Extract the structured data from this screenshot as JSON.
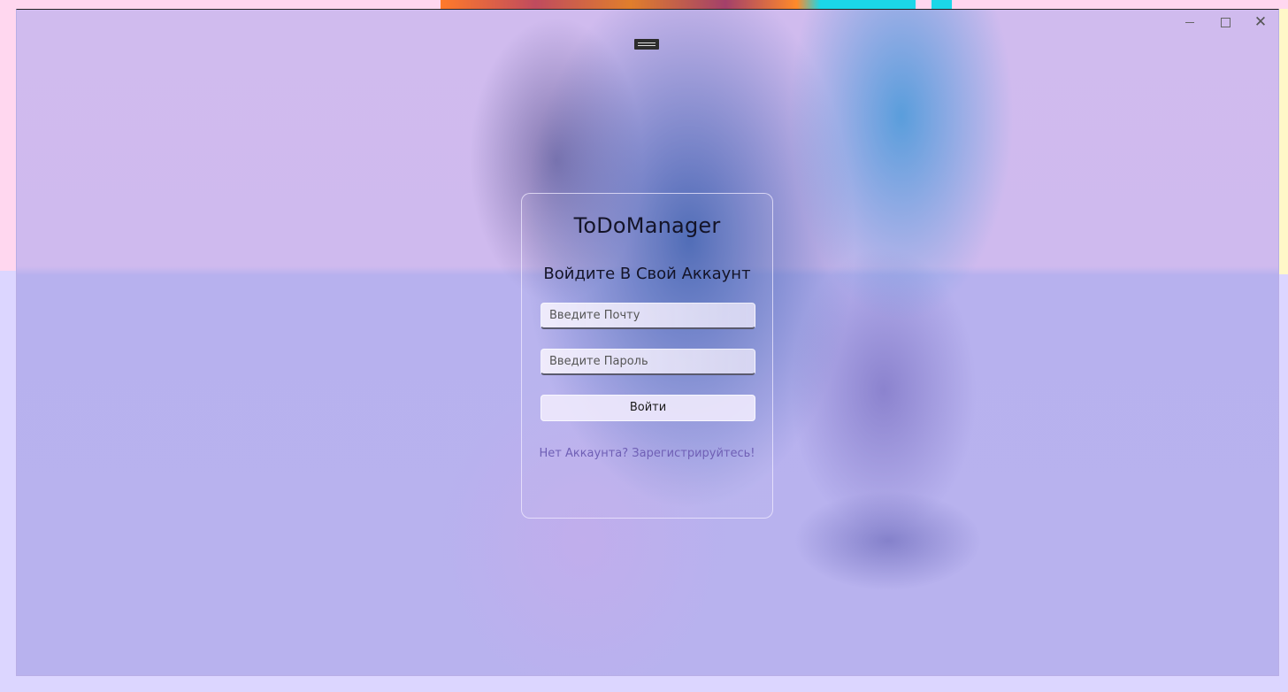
{
  "window": {
    "caption_minimize": "–",
    "caption_maximize": "□",
    "caption_close": "✕",
    "icons": [
      "minimize-icon",
      "maximize-icon",
      "close-icon",
      "drag-handle-icon"
    ]
  },
  "login": {
    "app_title": "ToDoManager",
    "subtitle": "Войдите В Свой Аккаунт",
    "email_placeholder": "Введите Почту",
    "email_value": "",
    "password_placeholder": "Введите Пароль",
    "password_value": "",
    "submit_label": "Войти",
    "register_link": "Нет Аккаунта? Зарегистрируйтесь!"
  },
  "colors": {
    "accent_link": "#6f5fb5",
    "text_primary": "#141428",
    "background_lavender": "#b8b2ee",
    "background_top": "#d0bbee"
  }
}
